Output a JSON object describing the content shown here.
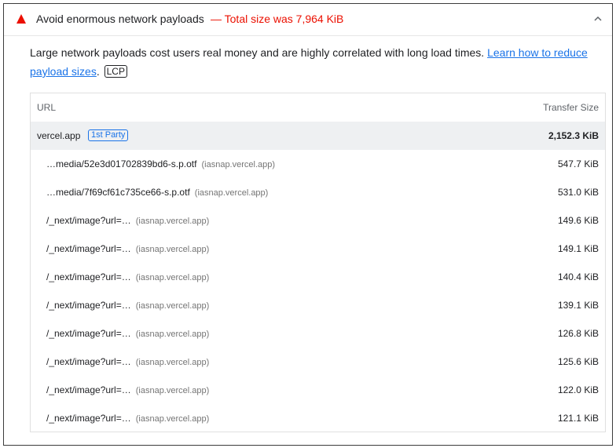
{
  "audit": {
    "title": "Avoid enormous network payloads",
    "display_value": "— Total size was 7,964 KiB",
    "status_icon": "warning-triangle-icon",
    "status_color": "#eb0f00",
    "expand_icon": "chevron-up-icon"
  },
  "description": {
    "text": "Large network payloads cost users real money and are highly correlated with long load times. ",
    "link_text": "Learn how to reduce payload sizes",
    "after_link": ".",
    "tag": "LCP",
    "link_color": "#1a73e8"
  },
  "table": {
    "headers": {
      "url": "URL",
      "size": "Transfer Size"
    },
    "group": {
      "name": "vercel.app",
      "badge": "1st Party",
      "size": "2,152.3 KiB"
    },
    "rows": [
      {
        "url": "…media/52e3d01702839bd6-s.p.otf",
        "host": "(iasnap.vercel.app)",
        "size": "547.7 KiB"
      },
      {
        "url": "…media/7f69cf61c735ce66-s.p.otf",
        "host": "(iasnap.vercel.app)",
        "size": "531.0 KiB"
      },
      {
        "url": "/_next/image?url=…",
        "host": "(iasnap.vercel.app)",
        "size": "149.6 KiB"
      },
      {
        "url": "/_next/image?url=…",
        "host": "(iasnap.vercel.app)",
        "size": "149.1 KiB"
      },
      {
        "url": "/_next/image?url=…",
        "host": "(iasnap.vercel.app)",
        "size": "140.4 KiB"
      },
      {
        "url": "/_next/image?url=…",
        "host": "(iasnap.vercel.app)",
        "size": "139.1 KiB"
      },
      {
        "url": "/_next/image?url=…",
        "host": "(iasnap.vercel.app)",
        "size": "126.8 KiB"
      },
      {
        "url": "/_next/image?url=…",
        "host": "(iasnap.vercel.app)",
        "size": "125.6 KiB"
      },
      {
        "url": "/_next/image?url=…",
        "host": "(iasnap.vercel.app)",
        "size": "122.0 KiB"
      },
      {
        "url": "/_next/image?url=…",
        "host": "(iasnap.vercel.app)",
        "size": "121.1 KiB"
      }
    ]
  }
}
